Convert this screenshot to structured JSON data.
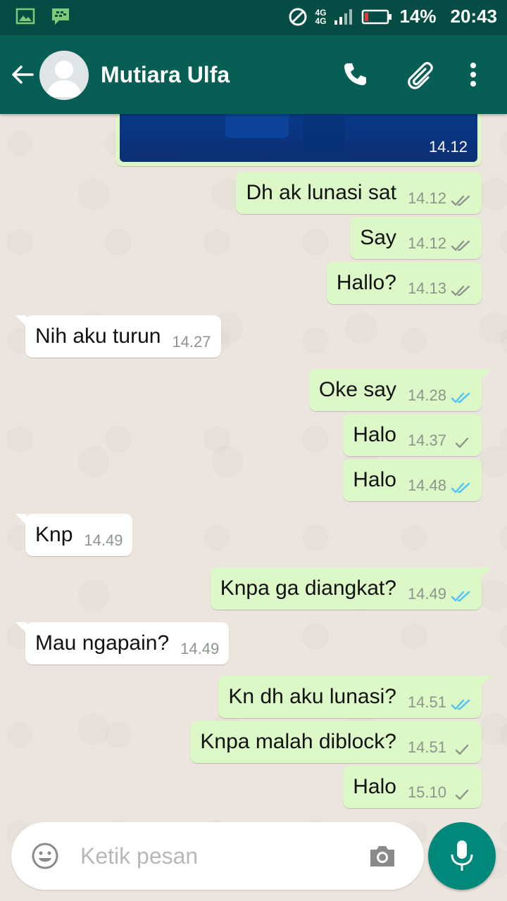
{
  "status_bar": {
    "network_top": "4G",
    "network_bottom": "4G",
    "battery": "14%",
    "time": "20:43"
  },
  "header": {
    "contact_name": "Mutiara Ulfa"
  },
  "image_message": {
    "time": "14.12",
    "status": "read"
  },
  "messages": [
    {
      "dir": "out",
      "text": "Dh ak lunasi sat",
      "time": "14.12",
      "status": "delivered"
    },
    {
      "dir": "out",
      "text": "Say",
      "time": "14.12",
      "status": "delivered"
    },
    {
      "dir": "out",
      "text": "Hallo?",
      "time": "14.13",
      "status": "delivered"
    },
    {
      "dir": "in",
      "text": "Nih aku turun",
      "time": "14.27"
    },
    {
      "dir": "out",
      "text": "Oke say",
      "time": "14.28",
      "status": "read"
    },
    {
      "dir": "out",
      "text": "Halo",
      "time": "14.37",
      "status": "sent"
    },
    {
      "dir": "out",
      "text": "Halo",
      "time": "14.48",
      "status": "read"
    },
    {
      "dir": "in",
      "text": "Knp",
      "time": "14.49"
    },
    {
      "dir": "out",
      "text": "Knpa ga diangkat?",
      "time": "14.49",
      "status": "read"
    },
    {
      "dir": "in",
      "text": "Mau ngapain?",
      "time": "14.49"
    },
    {
      "dir": "out",
      "text": "Kn dh aku lunasi?",
      "time": "14.51",
      "status": "read"
    },
    {
      "dir": "out",
      "text": "Knpa malah diblock?",
      "time": "14.51",
      "status": "sent"
    },
    {
      "dir": "out",
      "text": "Halo",
      "time": "15.10",
      "status": "sent"
    }
  ],
  "input": {
    "placeholder": "Ketik pesan"
  },
  "colors": {
    "header": "#075e54",
    "status_bar": "#054d44",
    "outgoing": "#dcf8c6",
    "incoming": "#ffffff",
    "read_tick": "#4fc3f7",
    "gray_tick": "#8c958c",
    "fab": "#00897b"
  }
}
